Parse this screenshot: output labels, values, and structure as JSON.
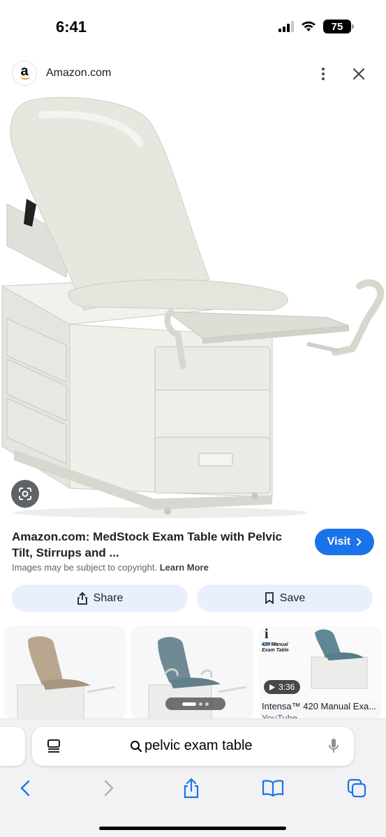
{
  "status_bar": {
    "time": "6:41",
    "battery": "75"
  },
  "source": {
    "logo_letter": "a",
    "name": "Amazon.com"
  },
  "result": {
    "title": "Amazon.com: MedStock Exam Table with Pelvic Tilt, Stirrups and ...",
    "visit_label": "Visit",
    "copyright_note": "Images may be subject to copyright.",
    "learn_more": "Learn More",
    "share_label": "Share",
    "save_label": "Save"
  },
  "related": {
    "video_duration": "3:36",
    "third_caption": "Intensa™ 420 Manual Exa...",
    "third_source": "YouTube",
    "third_thumb_text_1": "420 Manual",
    "third_thumb_text_2": "Exam Table"
  },
  "browser": {
    "address_text": "pelvic exam table"
  },
  "colors": {
    "accent": "#1a73e8",
    "pill_bg": "#e8f0fe",
    "table_color": "#dcdfd4"
  }
}
